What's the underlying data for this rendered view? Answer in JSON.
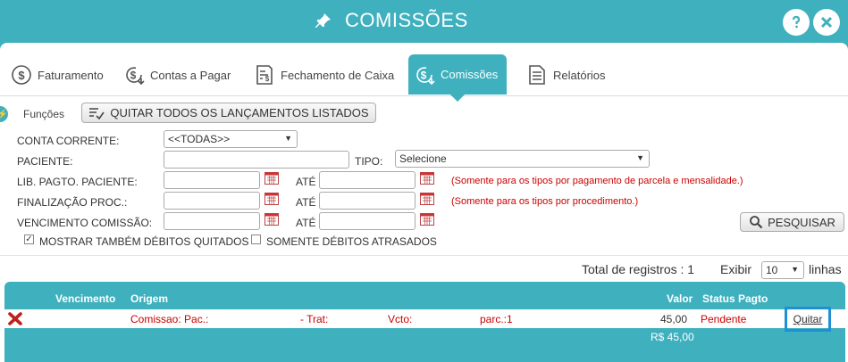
{
  "window": {
    "title": "COMISSÕES"
  },
  "tabs": [
    {
      "label": "Faturamento"
    },
    {
      "label": "Contas a Pagar"
    },
    {
      "label": "Fechamento de Caixa"
    },
    {
      "label": "Comissões"
    },
    {
      "label": "Relatórios"
    }
  ],
  "functions": {
    "label": "Funções",
    "quit_all_label": "QUITAR TODOS OS LANÇAMENTOS LISTADOS"
  },
  "filters": {
    "conta_corrente_label": "CONTA CORRENTE:",
    "conta_corrente_value": "<<TODAS>>",
    "paciente_label": "PACIENTE:",
    "tipo_label": "TIPO:",
    "tipo_value": "Selecione",
    "lib_pagto_label": "LIB. PAGTO. PACIENTE:",
    "finalizacao_label": "FINALIZAÇÃO PROC.:",
    "vencimento_label": "VENCIMENTO COMISSÃO:",
    "ate_label": "ATÉ",
    "note_parcela": "(Somente para os tipos por pagamento de parcela e mensalidade.)",
    "note_procedimento": "(Somente para os tipos por procedimento.)",
    "search_label": "PESQUISAR",
    "chk_quitados_label": "MOSTRAR TAMBÉM DÉBITOS QUITADOS",
    "chk_atrasados_label": "SOMENTE DÉBITOS ATRASADOS"
  },
  "summary": {
    "total_label": "Total de registros : 1",
    "show_label": "Exibir",
    "per_page": "10",
    "lines_label": "linhas"
  },
  "table": {
    "headers": {
      "vencimento": "Vencimento",
      "origem": "Origem",
      "valor": "Valor",
      "status": "Status Pagto"
    },
    "rows": [
      {
        "origem": "Comissao: Pac.:",
        "trat": "- Trat:",
        "vcto": "Vcto:",
        "parc": "parc.:1",
        "valor": "45,00",
        "status": "Pendente",
        "action": "Quitar"
      }
    ],
    "total": "R$ 45,00"
  },
  "colors": {
    "accent": "#3fb0be",
    "danger": "#cc0000",
    "highlight": "#1e90d6"
  }
}
